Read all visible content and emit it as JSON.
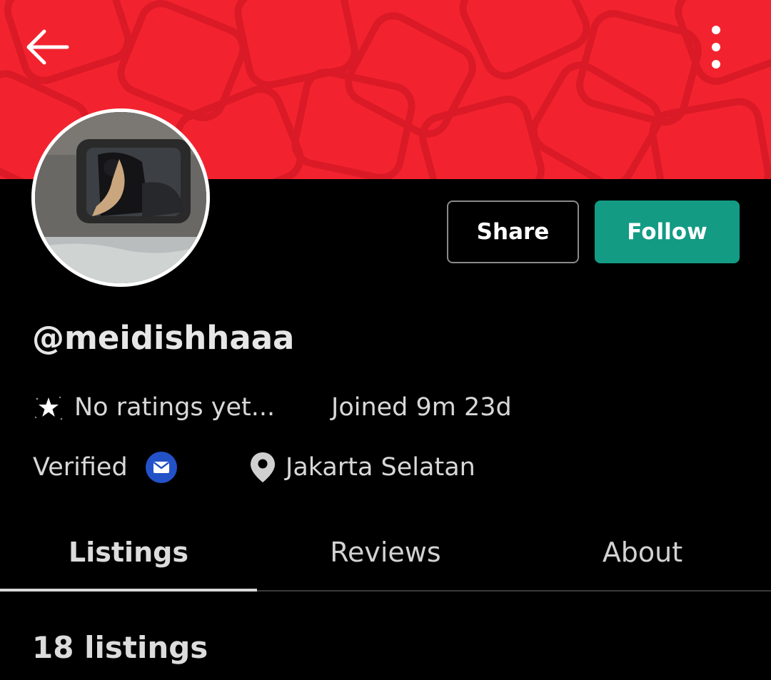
{
  "header": {
    "banner_color": "#f2232f",
    "back_icon": "arrow-left-icon",
    "more_icon": "more-vertical-icon"
  },
  "profile": {
    "avatar_icon": "profile-photo",
    "username": "@meidishhaaa",
    "rating_icon": "star-icon",
    "rating_text": "No ratings yet...",
    "joined_text": "Joined 9m 23d",
    "verified_label": "Verified",
    "verified_icon": "mail-icon",
    "location_icon": "map-pin-icon",
    "location": "Jakarta Selatan"
  },
  "actions": {
    "share_label": "Share",
    "follow_label": "Follow",
    "follow_color": "#139b84"
  },
  "tabs": [
    {
      "label": "Listings",
      "active": true
    },
    {
      "label": "Reviews",
      "active": false
    },
    {
      "label": "About",
      "active": false
    }
  ],
  "listings": {
    "count_label": "18 listings"
  }
}
